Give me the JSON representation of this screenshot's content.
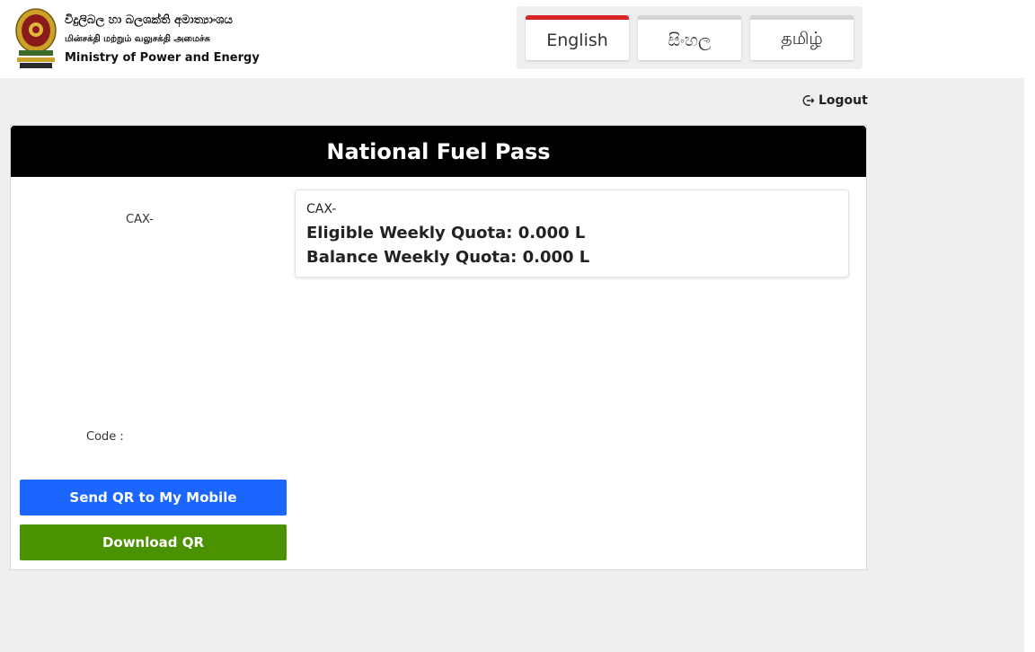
{
  "header": {
    "ministry_si": "විදුලිබල හා බලශක්ති අමාත්‍යාංශය",
    "ministry_ta": "மின்சக்தி மற்றும் வலுசக்தி அமைச்சு",
    "ministry_en": "Ministry of Power and Energy",
    "emblem_icon": "sri-lanka-emblem-icon"
  },
  "languages": [
    {
      "label": "English",
      "active": true
    },
    {
      "label": "සිංහල",
      "active": false
    },
    {
      "label": "தமிழ்",
      "active": false
    }
  ],
  "logout": {
    "label": "Logout",
    "icon": "logout-icon"
  },
  "card": {
    "title": "National Fuel Pass",
    "vehicle_number": "CAX-",
    "code_label": "Code :",
    "send_button": "Send QR to My Mobile",
    "download_button": "Download QR",
    "quota": {
      "vehicle_number": "CAX-",
      "eligible": "Eligible Weekly Quota: 0.000 L",
      "balance": "Balance Weekly Quota: 0.000 L"
    }
  },
  "colors": {
    "active_tab": "#d92525",
    "send_button": "#1a66ff",
    "download_button": "#4a9200",
    "card_header": "#000000",
    "page_background": "#efefef"
  }
}
